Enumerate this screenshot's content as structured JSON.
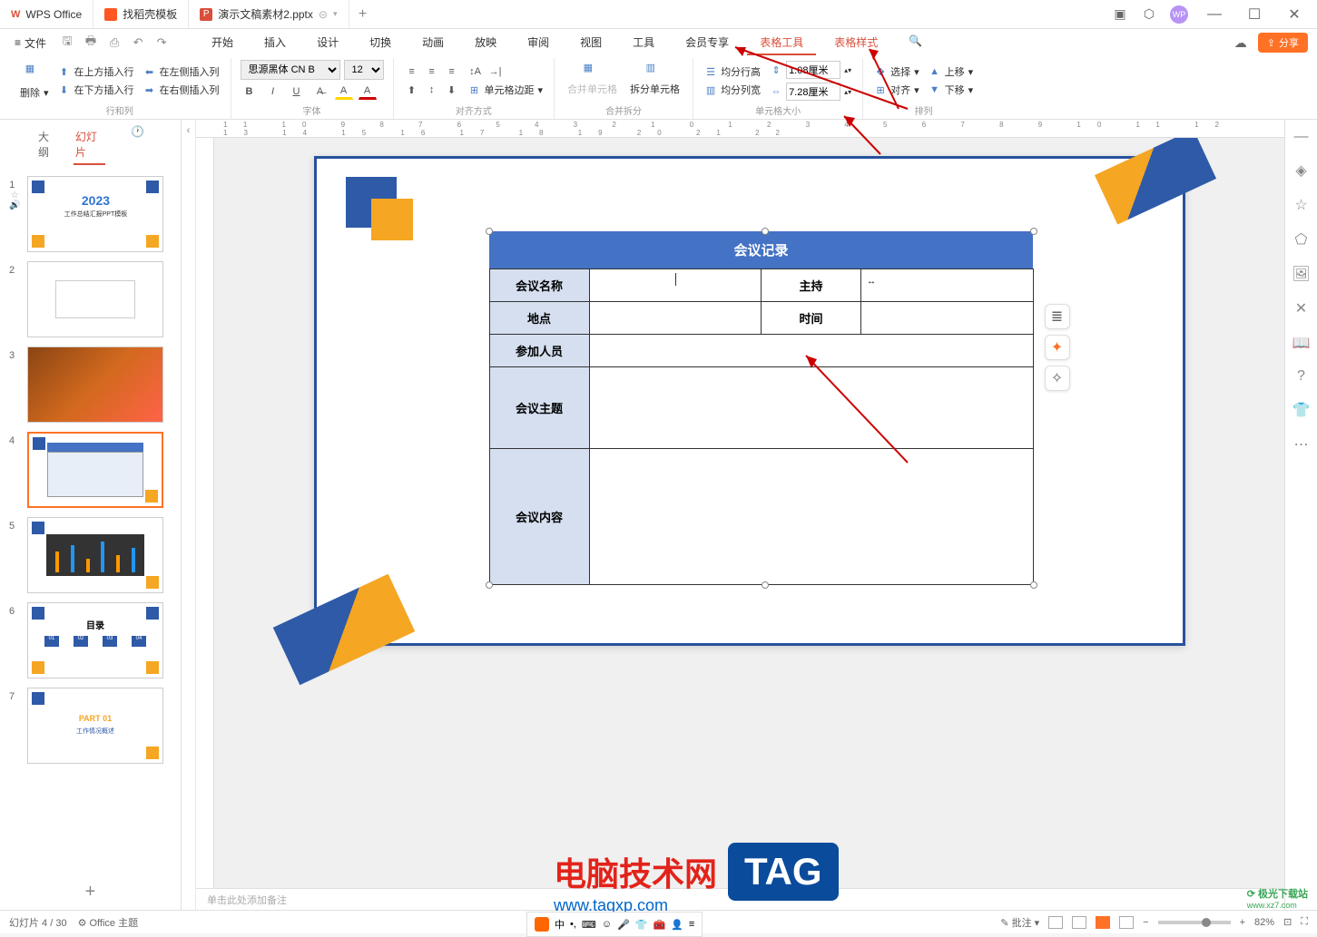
{
  "titlebar": {
    "app": "WPS Office",
    "tab_templates": "找稻壳模板",
    "doc_name": "演示文稿素材2.pptx",
    "add": "+"
  },
  "menubar": {
    "file": "文件",
    "tabs": [
      "开始",
      "插入",
      "设计",
      "切换",
      "动画",
      "放映",
      "审阅",
      "视图",
      "工具",
      "会员专享",
      "表格工具",
      "表格样式"
    ],
    "share": "分享"
  },
  "ribbon": {
    "rows_cols": {
      "label": "行和列",
      "delete": "删除",
      "insert_above": "在上方插入行",
      "insert_below": "在下方插入行",
      "insert_left": "在左侧插入列",
      "insert_right": "在右侧插入列"
    },
    "font": {
      "label": "字体",
      "family": "思源黑体 CN B",
      "size": "12"
    },
    "align": {
      "label": "对齐方式",
      "cell_margin": "单元格边距"
    },
    "merge": {
      "label": "合并拆分",
      "merge_cells": "合并单元格",
      "split_cells": "拆分单元格"
    },
    "cellsize": {
      "label": "单元格大小",
      "dist_rows": "均分行高",
      "dist_cols": "均分列宽",
      "row_h": "1.08厘米",
      "col_w": "7.28厘米"
    },
    "arrange": {
      "label": "排列",
      "select": "选择",
      "align": "对齐",
      "move_up": "上移",
      "move_down": "下移"
    }
  },
  "panel": {
    "tab_outline": "大纲",
    "tab_slides": "幻灯片"
  },
  "slides": [
    {
      "num": "1",
      "title": "2023",
      "sub": "工作总结汇报PPT模板"
    },
    {
      "num": "2"
    },
    {
      "num": "3"
    },
    {
      "num": "4"
    },
    {
      "num": "5"
    },
    {
      "num": "6",
      "title": "目录"
    },
    {
      "num": "7",
      "title": "PART 01",
      "sub": "工作情况概述"
    }
  ],
  "table": {
    "title": "会议记录",
    "rows": [
      [
        "会议名称",
        "",
        "主持",
        ""
      ],
      [
        "地点",
        "",
        "时间",
        ""
      ],
      [
        "参加人员",
        "",
        "",
        ""
      ],
      [
        "会议主题",
        "",
        "",
        ""
      ],
      [
        "会议内容",
        "",
        "",
        ""
      ]
    ]
  },
  "notes": {
    "placeholder": "单击此处添加备注"
  },
  "status": {
    "slide_count": "幻灯片 4 / 30",
    "theme": "Office 主题",
    "comments": "批注",
    "zoom": "82%",
    "ime": "中"
  },
  "watermark": {
    "text": "电脑技术网",
    "url": "www.tagxp.com",
    "tag": "TAG",
    "logo2a": "极光下载站",
    "logo2b": "www.xz7.com"
  }
}
